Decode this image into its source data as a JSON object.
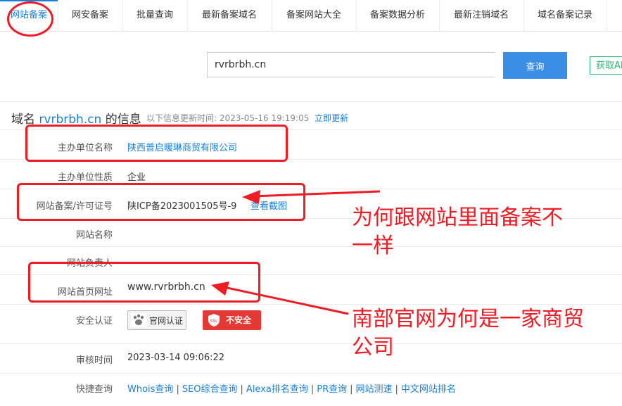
{
  "nav": {
    "items": [
      {
        "label": "网站备案",
        "active": true
      },
      {
        "label": "网安备案"
      },
      {
        "label": "批量查询"
      },
      {
        "label": "最新备案域名"
      },
      {
        "label": "备案网站大全"
      },
      {
        "label": "备案数据分析"
      },
      {
        "label": "最新注销域名"
      },
      {
        "label": "域名备案记录"
      }
    ]
  },
  "search": {
    "value": "rvrbrbh.cn",
    "button_label": "查询",
    "api_label": "获取API"
  },
  "info": {
    "title_prefix": "域名",
    "domain": "rvrbrbh.cn",
    "title_suffix": "的信息",
    "update_prefix": "以下信息更新时间:",
    "update_time": "2023-05-16 19:19:05",
    "refresh_label": "立即更新"
  },
  "rows": {
    "org_name": {
      "label": "主办单位名称",
      "value": "陕西普启暖琳商贸有限公司"
    },
    "org_type": {
      "label": "主办单位性质",
      "value": "企业"
    },
    "license": {
      "label": "网站备案/许可证号",
      "value": "陕ICP备2023001505号-9",
      "action": "查看截图"
    },
    "site_name": {
      "label": "网站名称",
      "value": ""
    },
    "site_owner": {
      "label": "网站负责人",
      "value": ""
    },
    "homepage": {
      "label": "网站首页网址",
      "value": "www.rvrbrbh.cn"
    },
    "security": {
      "label": "安全认证",
      "badge_official": "官网认证",
      "badge_unsafe": "不安全",
      "unsafe_icon_text": "SSL"
    },
    "review_time": {
      "label": "审核时间",
      "value": "2023-03-14 09:06:22"
    },
    "quick": {
      "label": "快捷查询",
      "links": [
        "Whois查询",
        "SEO综合查询",
        "Alexa排名查询",
        "PR查询",
        "网站测速",
        "中文网站排名"
      ]
    }
  },
  "annotations": {
    "note1": [
      "为何跟网站里面备案不",
      "一样"
    ],
    "note2": [
      "南部官网为何是一家商贸",
      "公司"
    ],
    "color": "#ee1c25"
  },
  "colors": {
    "accent": "#1a7fd4",
    "search_button": "#3a8ee6",
    "api_green": "#2fb574",
    "unsafe_red": "#e53935"
  }
}
